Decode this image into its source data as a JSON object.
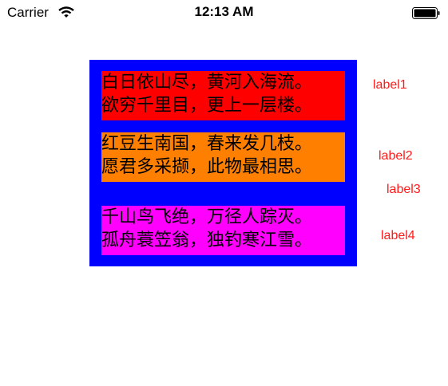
{
  "status_bar": {
    "carrier": "Carrier",
    "time": "12:13 AM",
    "wifi_icon": "wifi-icon",
    "battery_icon": "battery-icon"
  },
  "colors": {
    "container": "#0000ff",
    "label1_bg": "#ff0000",
    "label2_bg": "#ff8000",
    "label4_bg": "#ff00ff",
    "side_label_text": "#ff1a1a"
  },
  "poems": [
    {
      "line1": "白日依山尽，黄河入海流。",
      "line2": "欲穷千里目，更上一层楼。"
    },
    {
      "line1": "红豆生南国，春来发几枝。",
      "line2": "愿君多采撷，此物最相思。"
    },
    {
      "line1": "千山鸟飞绝，万径人踪灭。",
      "line2": "孤舟蓑笠翁，独钓寒江雪。"
    }
  ],
  "side_labels": {
    "label1": "label1",
    "label2": "label2",
    "label3": "label3",
    "label4": "label4"
  }
}
